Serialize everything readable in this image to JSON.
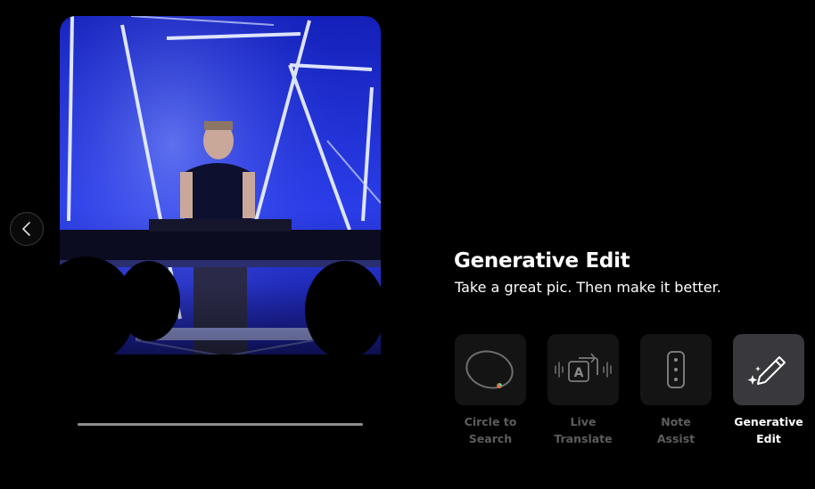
{
  "carousel": {
    "prev_icon": "chevron-left-icon",
    "image_subject": "dj-on-stage-photo",
    "progress": 1.0
  },
  "feature": {
    "title": "Generative Edit",
    "subtitle": "Take a great pic. Then make it better."
  },
  "tabs": [
    {
      "label": "Circle to\nSearch",
      "icon": "circle-search-icon",
      "active": false
    },
    {
      "label": "Live\nTranslate",
      "icon": "translate-icon",
      "active": false
    },
    {
      "label": "Note\nAssist",
      "icon": "note-icon",
      "active": false
    },
    {
      "label": "Generative\nEdit",
      "icon": "sparkle-pencil-icon",
      "active": true
    }
  ],
  "colors": {
    "background": "#000000",
    "stage_blue": "#2233dd",
    "active_tab_bg": "#38383d",
    "inactive_label": "#5d5d5d"
  }
}
